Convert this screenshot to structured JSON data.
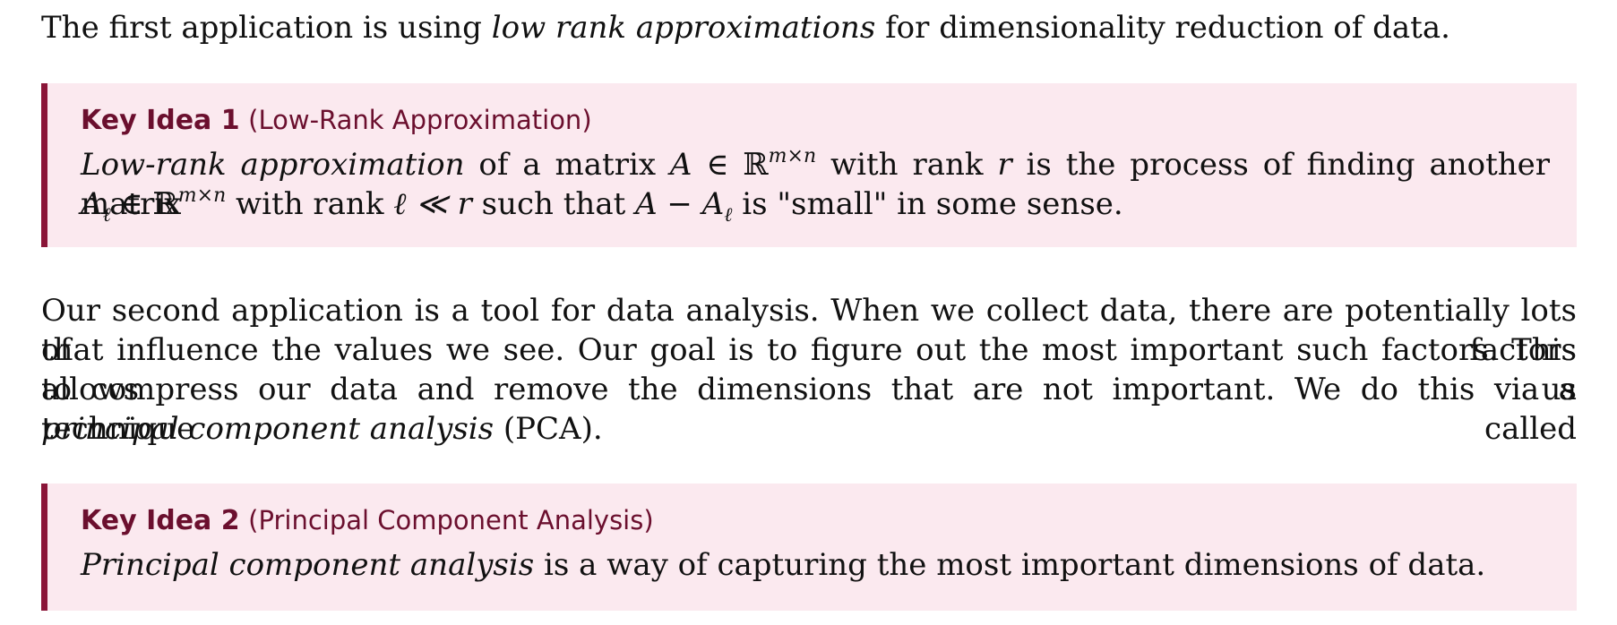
{
  "intro": {
    "pre": "The first application is using ",
    "emph": "low rank approximations",
    "post": " for dimensionality reduction of data."
  },
  "key_idea_1": {
    "title": "Key Idea 1",
    "subtitle": "(Low-Rank Approximation)",
    "line1": {
      "emph": "Low-rank approximation",
      "t1": " of a matrix ",
      "A": "A",
      "in": " ∈ ℝ",
      "sup": "m×n",
      "t2": " with rank ",
      "r": "r",
      "t3": " is the process of finding another matrix"
    },
    "line2": {
      "A": "A",
      "sub": "ℓ",
      "in": " ∈ ℝ",
      "sup": "m×n",
      "t1": " with rank ",
      "ell_rel": "ℓ ≪ r",
      "t2": " such that ",
      "expr_a": "A − A",
      "expr_sub": "ℓ",
      "t3": " is \"small\" in some sense."
    }
  },
  "second": {
    "line1": "Our second application is a tool for data analysis. When we collect data, there are potentially lots of factors",
    "line2": "that influence the values we see. Our goal is to figure out the most important such factors. This allows us",
    "line3": "to compress our data and remove the dimensions that are not important. We do this via a technique called",
    "line4_emph": "principal component analysis",
    "line4_post": " (PCA)."
  },
  "key_idea_2": {
    "title": "Key Idea 2",
    "subtitle": "(Principal Component Analysis)",
    "emph": "Principal component analysis",
    "post": " is a way of capturing the most important dimensions of data."
  },
  "colors": {
    "box_background": "#fbe9ef",
    "box_rule": "#8a1538",
    "heading": "#6b0f2e",
    "text": "#111111"
  }
}
